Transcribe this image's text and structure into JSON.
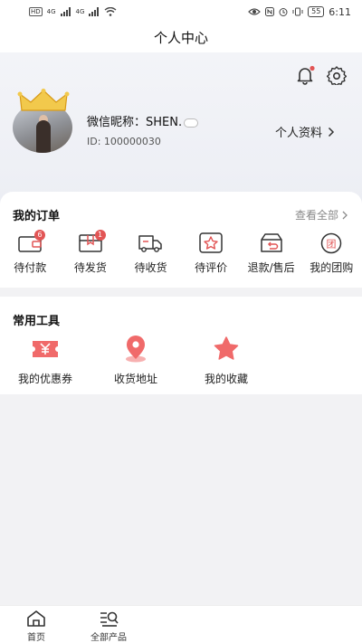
{
  "status_bar": {
    "left_tags": [
      "HD",
      "HD"
    ],
    "signal_labels": [
      "4G",
      "4G"
    ],
    "battery": "55",
    "time": "6:11"
  },
  "nav": {
    "title": "个人中心"
  },
  "profile": {
    "nickname": "微信昵称：SHEN.",
    "user_id": "ID: 100000030",
    "profile_link": "个人资料"
  },
  "orders": {
    "title": "我的订单",
    "view_all": "查看全部",
    "items": [
      {
        "label": "待付款",
        "badge": "6",
        "icon": "wallet-icon"
      },
      {
        "label": "待发货",
        "badge": "1",
        "icon": "package-icon"
      },
      {
        "label": "待收货",
        "badge": "",
        "icon": "truck-icon"
      },
      {
        "label": "待评价",
        "badge": "",
        "icon": "star-icon"
      },
      {
        "label": "退款/售后",
        "badge": "",
        "icon": "refund-icon"
      },
      {
        "label": "我的团购",
        "badge": "",
        "icon": "group-buy-icon"
      }
    ]
  },
  "tools": {
    "title": "常用工具",
    "items": [
      {
        "label": "我的优惠券",
        "icon": "coupon-icon"
      },
      {
        "label": "收货地址",
        "icon": "location-icon"
      },
      {
        "label": "我的收藏",
        "icon": "favorite-star-icon"
      }
    ]
  },
  "tabbar": {
    "items": [
      {
        "label": "首页",
        "icon": "home-icon"
      },
      {
        "label": "全部产品",
        "icon": "product-list-icon"
      }
    ]
  },
  "colors": {
    "accent_red": "#e25555",
    "tool_red": "#f06a6a",
    "background": "#f2f2f4"
  }
}
